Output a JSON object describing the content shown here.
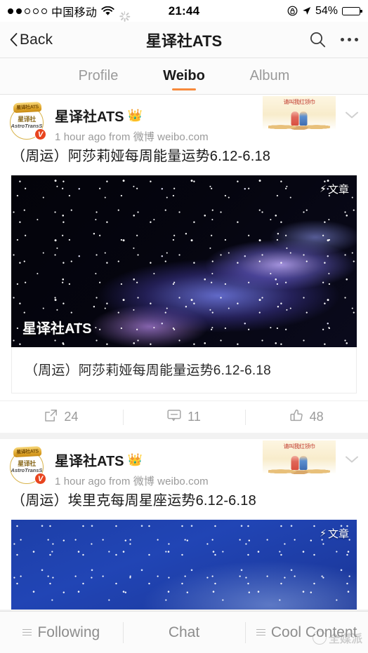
{
  "status_bar": {
    "signal_dots_filled": 2,
    "signal_dots_total": 5,
    "carrier": "中国移动",
    "wifi_icon": "wifi-icon",
    "activity_icon": "activity-spinner-icon",
    "time": "21:44",
    "rotation_lock_icon": "rotation-lock-icon",
    "location_icon": "location-arrow-icon",
    "battery_percent": "54%",
    "battery_level": 54
  },
  "nav": {
    "back_label": "Back",
    "back_icon": "chevron-left-icon",
    "title": "星译社ATS",
    "search_icon": "search-icon",
    "more_icon": "more-horizontal-icon"
  },
  "tabs": [
    {
      "label": "Profile",
      "active": false
    },
    {
      "label": "Weibo",
      "active": true
    },
    {
      "label": "Album",
      "active": false
    }
  ],
  "accent_color": "#f7893b",
  "verified_color": "#e8451f",
  "posts": [
    {
      "avatar": {
        "line1": "星译社",
        "line2": "AstroTransS",
        "crown_label": "星译社ATS",
        "badge": "V"
      },
      "username": "星译社ATS",
      "username_badge": "👑",
      "time": "1 hour ago",
      "source_prefix": "from",
      "source": "微博 weibo.com",
      "promo_text": "请叫我红领巾",
      "collapse_icon": "chevron-down-icon",
      "text": "（周运）阿莎莉娅每周能量运势6.12-6.18",
      "media": {
        "type": "nebula",
        "article_badge": "文章",
        "bolt_icon": "lightning-bolt-icon",
        "watermark": "星译社ATS"
      },
      "article_card_title": "（周运）阿莎莉娅每周能量运势6.12-6.18",
      "actions": [
        {
          "icon": "repost-icon",
          "count": "24"
        },
        {
          "icon": "comment-icon",
          "count": "11"
        },
        {
          "icon": "like-thumbs-up-icon",
          "count": "48"
        }
      ]
    },
    {
      "avatar": {
        "line1": "星译社",
        "line2": "AstroTransS",
        "crown_label": "星译社ATS",
        "badge": "V"
      },
      "username": "星译社ATS",
      "username_badge": "👑",
      "time": "1 hour ago",
      "source_prefix": "from",
      "source": "微博 weibo.com",
      "promo_text": "请叫我红领巾",
      "collapse_icon": "chevron-down-icon",
      "text": "（周运）埃里克每周星座运势6.12-6.18",
      "media": {
        "type": "starfield",
        "article_badge": "文章",
        "bolt_icon": "lightning-bolt-icon",
        "watermark": ""
      }
    }
  ],
  "bottom_bar": {
    "items": [
      {
        "label": "Following",
        "icon": "menu-lines-icon",
        "has_icon": true
      },
      {
        "label": "Chat",
        "icon": "",
        "has_icon": false
      },
      {
        "label": "Cool Content",
        "icon": "menu-lines-icon",
        "has_icon": true
      }
    ],
    "watermark": "全媒派"
  }
}
